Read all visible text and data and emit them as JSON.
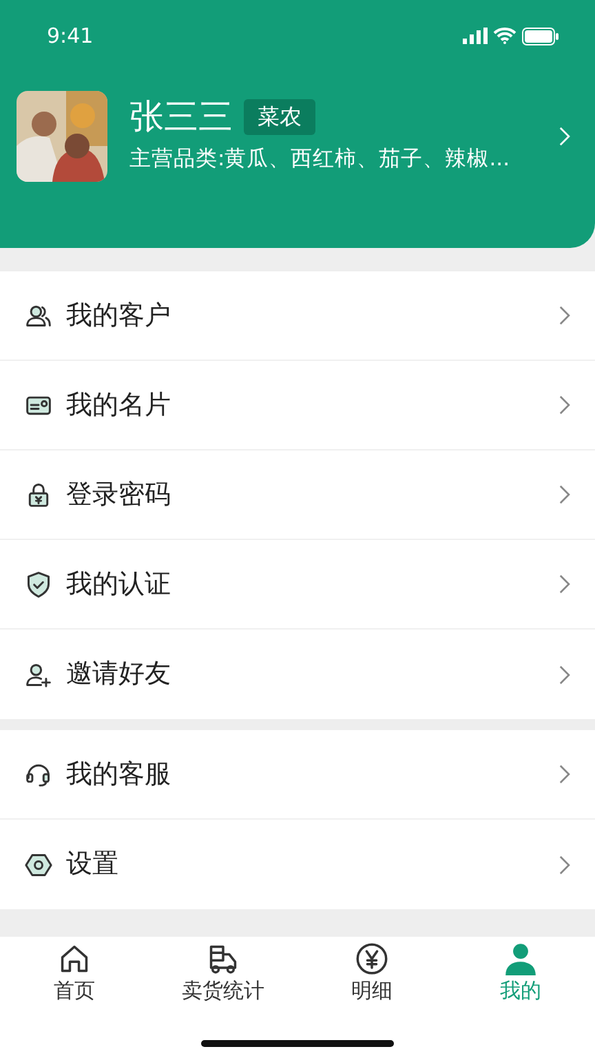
{
  "status_bar": {
    "time": "9:41"
  },
  "profile": {
    "name": "张三三",
    "tag": "菜农",
    "categories": "主营品类:黄瓜、西红柿、茄子、辣椒..."
  },
  "menu_groups": [
    {
      "items": [
        {
          "label": "我的客户"
        },
        {
          "label": "我的名片"
        },
        {
          "label": "登录密码"
        },
        {
          "label": "我的认证"
        },
        {
          "label": "邀请好友"
        }
      ]
    },
    {
      "items": [
        {
          "label": "我的客服"
        },
        {
          "label": "设置"
        }
      ]
    }
  ],
  "tab_bar": [
    {
      "label": "首页",
      "selected": false
    },
    {
      "label": "卖货统计",
      "selected": false
    },
    {
      "label": "明细",
      "selected": false
    },
    {
      "label": "我的",
      "selected": true
    }
  ]
}
